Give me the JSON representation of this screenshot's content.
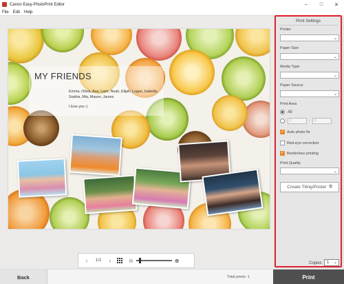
{
  "window": {
    "title": "Canon Easy-PhotoPrint Editor"
  },
  "menu": [
    "File",
    "Edit",
    "Help"
  ],
  "canvas": {
    "title": "MY FRIENDS",
    "names": "Emma, Olivia, Ava, Liam, Noah, Elijah, Logan, Isabella, Sophia, Mia, Mason, James",
    "love": "I love you :)"
  },
  "navigation": {
    "page_indicator": "1/1"
  },
  "panel": {
    "heading": "Print Settings",
    "printer_label": "Printer",
    "paper_size_label": "Paper Size",
    "media_type_label": "Media Type",
    "paper_source_label": "Paper Source",
    "print_area_label": "Print Area",
    "all_label": "All",
    "from_value": "1",
    "to_value": "1",
    "auto_photo_fix": "Auto photo fix",
    "red_eye": "Red-eye correction",
    "borderless": "Borderless printing",
    "print_quality_label": "Print Quality",
    "tiling_button": "Create Tiling/Poster",
    "copies_label": "Copies",
    "copies_value": "1"
  },
  "bottom": {
    "back": "Back",
    "total_prints": "Total prints: 1",
    "print": "Print"
  },
  "colors": {
    "highlight_border": "#e0202c",
    "checkbox_on": "#e6892a",
    "print_button": "#504f50"
  }
}
